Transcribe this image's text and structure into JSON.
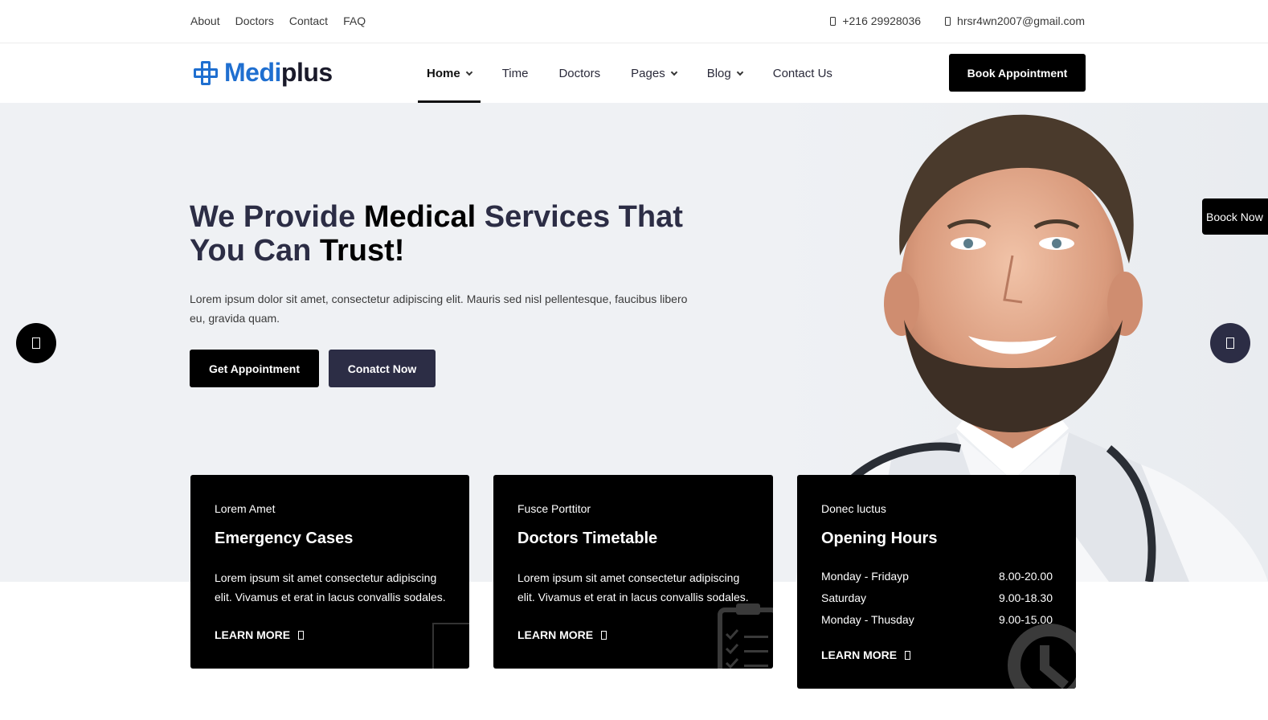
{
  "topbar": {
    "links": [
      "About",
      "Doctors",
      "Contact",
      "FAQ"
    ],
    "phone": "+216 29928036",
    "email": "hrsr4wn2007@gmail.com",
    "phone_icon": "phone-icon",
    "email_icon": "envelope-icon"
  },
  "header": {
    "logo": {
      "part1": "Medi",
      "part2": "plus",
      "icon": "medical-cross-icon",
      "color": "#1f6fd0"
    },
    "nav": [
      "Home",
      "Time",
      "Doctors",
      "Pages",
      "Blog",
      "Contact Us"
    ],
    "active_nav": "Home",
    "book_button": "Book Appointment"
  },
  "hero": {
    "title_part1": "We Provide ",
    "title_em1": "Medical",
    "title_part2": " Services That You Can ",
    "title_em2": "Trust!",
    "description": "Lorem ipsum dolor sit amet, consectetur adipiscing elit. Mauris sed nisl pellentesque, faucibus libero eu, gravida quam.",
    "btn_get": "Get Appointment",
    "btn_contact": "Conatct Now",
    "side_button": "Boock Now",
    "prev_icon": "arrow-left-icon",
    "next_icon": "arrow-right-icon"
  },
  "cards": [
    {
      "kicker": "Lorem Amet",
      "title": "Emergency Cases",
      "desc": "Lorem ipsum sit amet consectetur adipiscing elit. Vivamus et erat in lacus convallis sodales.",
      "more": "LEARN MORE"
    },
    {
      "kicker": "Fusce Porttitor",
      "title": "Doctors Timetable",
      "desc": "Lorem ipsum sit amet consectetur adipiscing elit. Vivamus et erat in lacus convallis sodales.",
      "more": "LEARN MORE"
    },
    {
      "kicker": "Donec luctus",
      "title": "Opening Hours",
      "hours": [
        {
          "day": "Monday - Fridayp",
          "time": "8.00-20.00"
        },
        {
          "day": "Saturday",
          "time": "9.00-18.30"
        },
        {
          "day": "Monday - Thusday",
          "time": "9.00-15.00"
        }
      ],
      "more": "LEARN MORE"
    }
  ],
  "colors": {
    "primary": "#1f6fd0",
    "dark": "#2c2d45",
    "black": "#000000",
    "hero_bg": "#eff1f4"
  }
}
